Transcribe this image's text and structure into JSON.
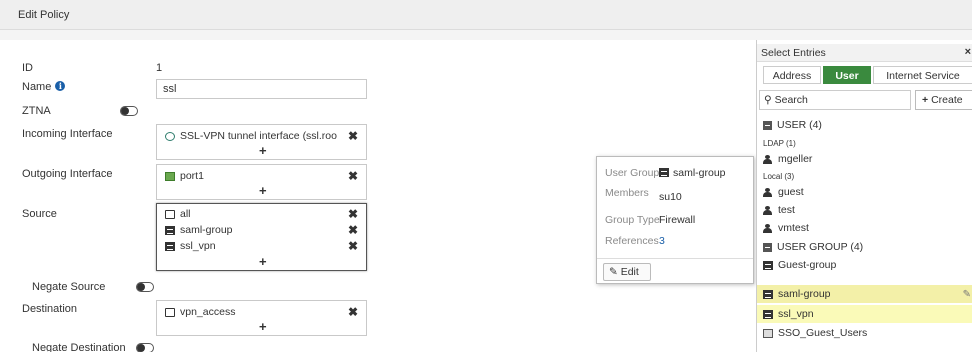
{
  "window": {
    "title": "Edit Policy"
  },
  "form": {
    "id_label": "ID",
    "id_value": "1",
    "name_label": "Name",
    "name_value": "ssl",
    "ztna_label": "ZTNA",
    "incoming_label": "Incoming Interface",
    "incoming_entry": "SSL-VPN tunnel interface (ssl.roo",
    "outgoing_label": "Outgoing Interface",
    "outgoing_entry": "port1",
    "source_label": "Source",
    "source_entries": [
      "all",
      "saml-group",
      "ssl_vpn"
    ],
    "negate_source_label": "Negate Source",
    "destination_label": "Destination",
    "destination_entry": "vpn_access",
    "negate_destination_label": "Negate Destination"
  },
  "popup": {
    "user_group_key": "User Group",
    "user_group_value": "saml-group",
    "members_key": "Members",
    "members_value": "su10",
    "group_type_key": "Group Type",
    "group_type_value": "Firewall",
    "references_key": "References",
    "references_value": "3",
    "edit_label": "Edit"
  },
  "select_panel": {
    "title": "Select Entries",
    "close": "×",
    "tabs": [
      "Address",
      "User",
      "Internet Service"
    ],
    "active_tab": "User",
    "search_placeholder": "Search",
    "create_label": "Create",
    "user_header": "USER (4)",
    "ldap_label": "LDAP (1)",
    "ldap_user": "mgeller",
    "local_label": "Local (3)",
    "local_users": [
      "guest",
      "test",
      "vmtest"
    ],
    "group_header": "USER GROUP (4)",
    "groups": [
      "Guest-group",
      "saml-group",
      "ssl_vpn",
      "SSO_Guest_Users"
    ]
  },
  "colors": {
    "accent_green": "#3a8a3e",
    "highlight": "#f3f0a8",
    "link_blue": "#1a5fa8"
  }
}
